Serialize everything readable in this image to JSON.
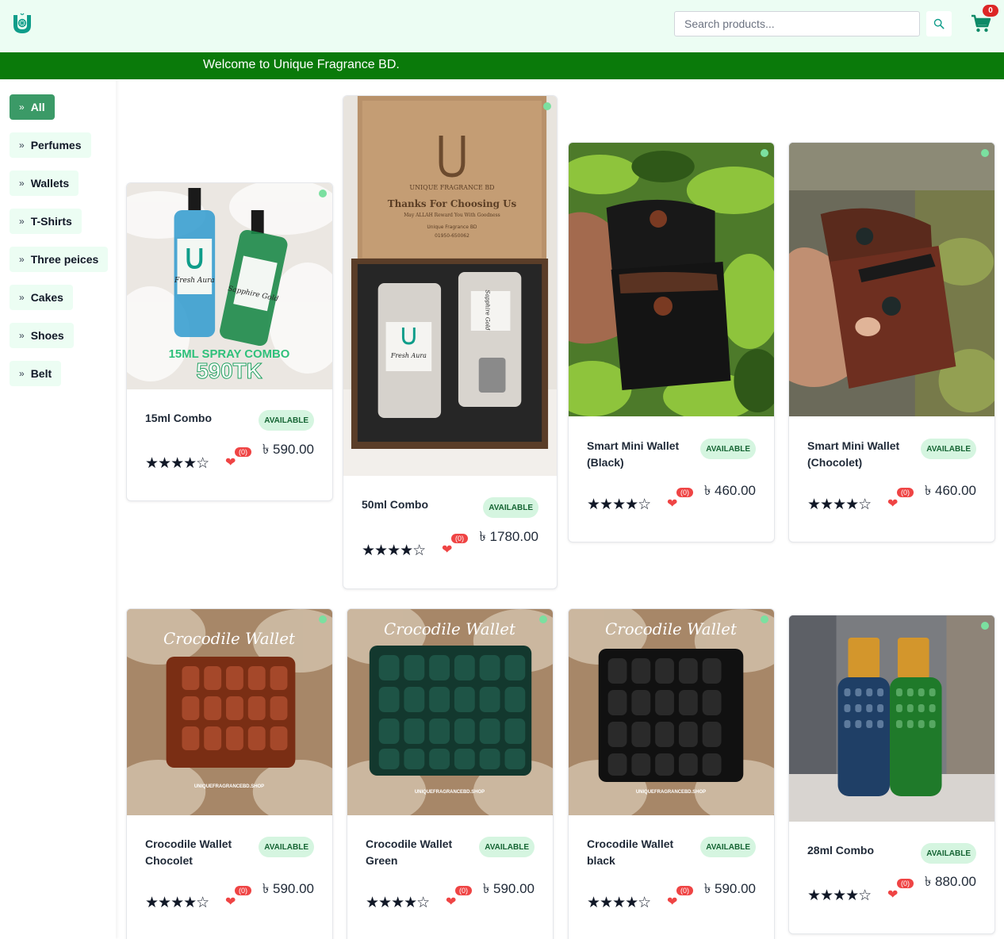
{
  "header": {
    "logo": "unique-fragrance-logo",
    "search_placeholder": "Search products...",
    "cart_count": "0"
  },
  "banner": {
    "text": "Welcome to Unique Fragrance BD."
  },
  "categories": [
    "All",
    "Perfumes",
    "Wallets",
    "T-Shirts",
    "Three peices",
    "Cakes",
    "Shoes",
    "Belt"
  ],
  "category_chevron": "»",
  "products": [
    {
      "name": "15ml Combo",
      "status": "AVAILABLE",
      "price": "৳ 590.00",
      "rating": 4,
      "likes": "(0)",
      "image_text": [
        "Fresh Aura",
        "Sapphire Gold",
        "15ML SPRAY COMBO",
        "590TK"
      ]
    },
    {
      "name": "50ml Combo",
      "status": "AVAILABLE",
      "price": "৳ 1780.00",
      "rating": 4,
      "likes": "(0)",
      "image_text": [
        "UNIQUE FRAGRANCE BD",
        "Thanks For Choosing Us",
        "May ALLAH Reward You With Goodness",
        "Unique Fragrance BD",
        "01950-650062",
        "Fresh Aura",
        "Sapphire Gold"
      ]
    },
    {
      "name": "Smart Mini Wallet (Black)",
      "status": "AVAILABLE",
      "price": "৳ 460.00",
      "rating": 4,
      "likes": "(0)"
    },
    {
      "name": "Smart Mini Wallet (Chocolet)",
      "status": "AVAILABLE",
      "price": "৳ 460.00",
      "rating": 4,
      "likes": "(0)"
    },
    {
      "name": "Crocodile Wallet Chocolet",
      "status": "AVAILABLE",
      "price": "৳ 590.00",
      "rating": 4,
      "likes": "(0)",
      "image_text": [
        "Crocodile Wallet",
        "UNIQUEFRAGRANCEBD.SHOP"
      ]
    },
    {
      "name": "Crocodile Wallet Green",
      "status": "AVAILABLE",
      "price": "৳ 590.00",
      "rating": 4,
      "likes": "(0)",
      "image_text": [
        "Crocodile Wallet",
        "UNIQUEFRAGRANCEBD.SHOP"
      ]
    },
    {
      "name": "Crocodile Wallet black",
      "status": "AVAILABLE",
      "price": "৳ 590.00",
      "rating": 4,
      "likes": "(0)",
      "image_text": [
        "Crocodile Wallet",
        "UNIQUEFRAGRANCEBD.SHOP"
      ]
    },
    {
      "name": "28ml Combo",
      "status": "AVAILABLE",
      "price": "৳ 880.00",
      "rating": 4,
      "likes": "(0)"
    }
  ],
  "colors": {
    "header_bg": "#ecfdf3",
    "banner_bg": "#0a7a0a",
    "active_category": "#3b9a67",
    "badge_bg": "#d5f5e0",
    "heart": "#ef4444",
    "logo": "#0f9d8a"
  }
}
